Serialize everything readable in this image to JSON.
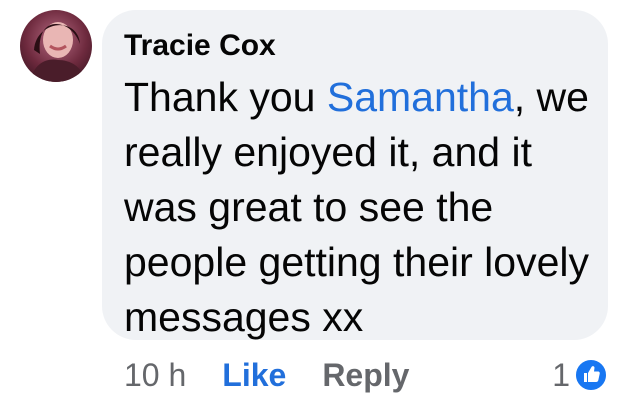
{
  "comment": {
    "author": "Tracie Cox",
    "text_before": "Thank you ",
    "mention": "Samantha",
    "text_after": ", we really enjoyed it, and it was great to see the people getting their lovely messages xx",
    "timestamp": "10 h",
    "like_label": "Like",
    "reply_label": "Reply",
    "reaction_count": "1",
    "reaction_icon": "thumbs-up-icon"
  },
  "colors": {
    "bubble": "#f0f2f5",
    "mention": "#216fdb",
    "like": "#216fdb",
    "muted": "#65676b",
    "text": "#050505"
  }
}
